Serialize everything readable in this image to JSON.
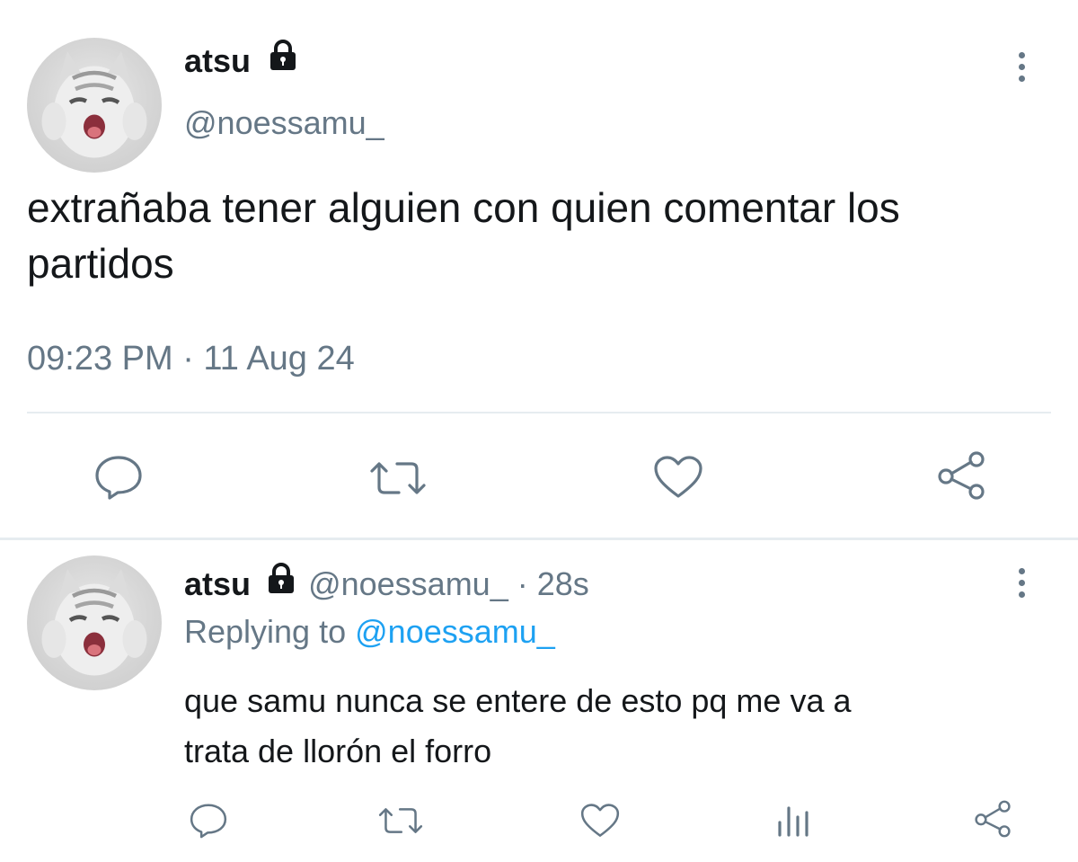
{
  "main_tweet": {
    "display_name": "atsu",
    "handle": "@noessamu_",
    "text": "extrañaba tener alguien con quien comentar los partidos",
    "timestamp": "09:23 PM · 11 Aug 24",
    "actions": [
      "reply-icon",
      "retweet-icon",
      "like-icon",
      "share-icon"
    ]
  },
  "reply_tweet": {
    "display_name": "atsu",
    "handle": "@noessamu_",
    "time_ago": "· 28s",
    "replying_label": "Replying to",
    "replying_handle": "@noessamu_",
    "text_line1": "que samu nunca se entere de esto pq me va a",
    "text_line2": "trata de llorón el forro",
    "actions": [
      "reply-icon",
      "retweet-icon",
      "like-icon",
      "analytics-icon",
      "share-icon"
    ]
  },
  "colors": {
    "text": "#14171a",
    "muted": "#657786",
    "link": "#1da1f2",
    "divider": "#e6ecf0"
  }
}
